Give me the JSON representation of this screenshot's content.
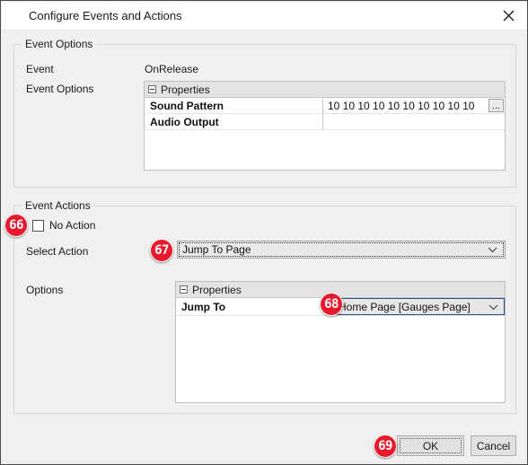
{
  "window": {
    "title": "Configure Events and Actions",
    "close_icon": "close-icon"
  },
  "event_options_group": {
    "title": "Event Options",
    "event_label": "Event",
    "event_value": "OnRelease",
    "event_options_label": "Event Options",
    "grid": {
      "header": "Properties",
      "rows": [
        {
          "name": "Sound Pattern",
          "value": "10 10 10 10 10 10 10 10 10 10",
          "has_ellipsis": true,
          "ellipsis_label": "..."
        },
        {
          "name": "Audio Output",
          "value": "",
          "has_ellipsis": false,
          "ellipsis_label": ""
        }
      ]
    }
  },
  "event_actions_group": {
    "title": "Event Actions",
    "no_action_label": "No Action",
    "no_action_checked": false,
    "select_action_label": "Select Action",
    "select_action_value": "Jump To Page",
    "options_label": "Options",
    "grid": {
      "header": "Properties",
      "rows": [
        {
          "name": "Jump To",
          "value": "Home Page [Gauges Page]"
        }
      ]
    }
  },
  "footer": {
    "ok_label": "OK",
    "cancel_label": "Cancel"
  },
  "annotations": {
    "badge_color": "#e8192c",
    "badge_66": "66",
    "badge_67": "67",
    "badge_68": "68",
    "badge_69": "69"
  }
}
